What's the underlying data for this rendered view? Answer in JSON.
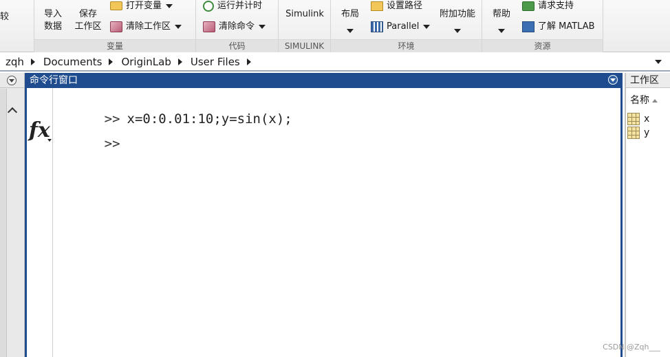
{
  "ribbon": {
    "partial_left": "较",
    "variable_group": {
      "label": "变量",
      "import_line1": "导入",
      "import_line2": "数据",
      "save_line1": "保存",
      "save_line2": "工作区",
      "open_variable": "打开变量",
      "clear_workspace": "清除工作区"
    },
    "code_group": {
      "label": "代码",
      "run_and_time": "运行并计时",
      "clear_commands": "清除命令"
    },
    "simulink_group": {
      "label": "SIMULINK",
      "simulink": "Simulink"
    },
    "env_group": {
      "label": "环境",
      "layout": "布局",
      "set_path": "设置路径",
      "parallel": "Parallel",
      "addons": "附加功能"
    },
    "resources_group": {
      "label": "资源",
      "help": "帮助",
      "request_support": "请求支持",
      "learn_matlab": "了解 MATLAB"
    }
  },
  "address_bar": {
    "crumbs": [
      "zqh",
      "Documents",
      "OriginLab",
      "User Files"
    ]
  },
  "command_window": {
    "title": "命令行窗口",
    "prompt": ">>",
    "history_command": "x=0:0.01:10;y=sin(x);",
    "current_input": "",
    "fx_label": "fx"
  },
  "workspace": {
    "title": "工作区",
    "name_column": "名称",
    "variables": [
      "x",
      "y"
    ]
  },
  "watermark": "CSDN @Zqh___"
}
